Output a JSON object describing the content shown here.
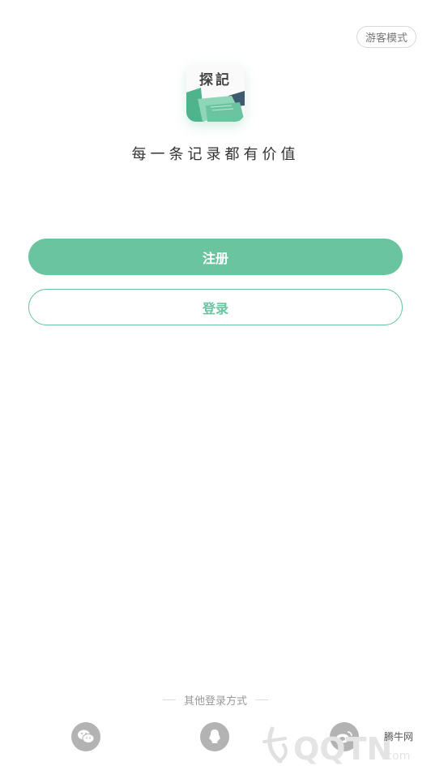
{
  "header": {
    "guest_mode_label": "游客模式"
  },
  "logo": {
    "text": "探記"
  },
  "slogan": "每一条记录都有价值",
  "buttons": {
    "register_label": "注册",
    "login_label": "登录"
  },
  "other_login": {
    "label": "其他登录方式",
    "options": [
      "wechat-icon",
      "qq-icon",
      "weibo-icon"
    ]
  },
  "watermark": {
    "brand": "QQTN",
    "suffix": ".com",
    "cn": "腾牛网"
  },
  "colors": {
    "accent": "#6ac4a0",
    "icon_gray": "#b3b3b3"
  }
}
